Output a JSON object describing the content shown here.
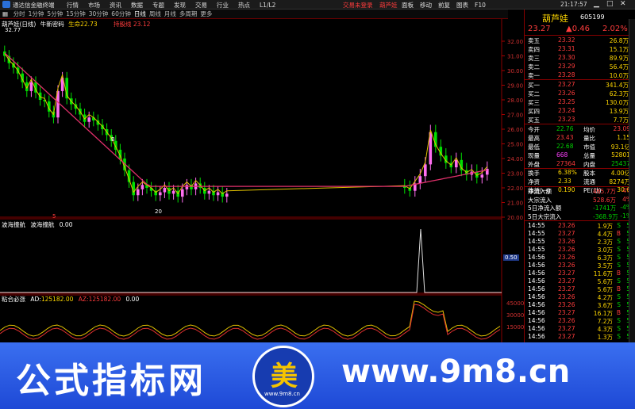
{
  "window": {
    "app_name": "通达信金融终端",
    "menu": [
      "行情",
      "市场",
      "资讯",
      "数据",
      "专题",
      "发现",
      "交易",
      "行业",
      "热点",
      "L1/L2"
    ],
    "login": "交易未登录",
    "stock_title": "葫芦娃",
    "toolbar": [
      "面板",
      "移动",
      "前复",
      "图表",
      "F10"
    ],
    "time": "21:17:57"
  },
  "chart_tabs": [
    "分时",
    "1分钟",
    "5分钟",
    "15分钟",
    "30分钟",
    "60分钟",
    "日线",
    "周线",
    "月线",
    "多周期",
    "更多"
  ],
  "main_chart": {
    "label": "葫芦娃(日线)",
    "formula": "牛新密码",
    "indicator": "生命",
    "indicator_value": "22.73",
    "support": "持股线",
    "support_value": "23.12",
    "high_label": "32.77",
    "low_label": "20",
    "price_axis": [
      "32.00",
      "31.00",
      "30.00",
      "29.00",
      "28.00",
      "27.00",
      "26.00",
      "25.00",
      "24.00",
      "23.00",
      "22.00",
      "21.00",
      "20.00"
    ],
    "marker": "B",
    "sub_value": "5"
  },
  "sub1": {
    "name": "波海撞航",
    "label": "波海撞航",
    "value": "0.00",
    "axis": "0.50"
  },
  "sub2": {
    "name": "粘合必涨",
    "ad_label": "AD:",
    "ad_value": "125182.00",
    "az_label": "AZ:",
    "az_value": "125182.00",
    "extra": "0.00",
    "axis": [
      "45000",
      "30000",
      "15000"
    ]
  },
  "quote": {
    "name": "葫芦娃",
    "code": "605199",
    "price": "23.27",
    "change": "▲0.46",
    "pct": "2.02%",
    "asks": [
      {
        "l": "卖五",
        "p": "23.32",
        "v": "26.8万"
      },
      {
        "l": "卖四",
        "p": "23.31",
        "v": "15.1万"
      },
      {
        "l": "卖三",
        "p": "23.30",
        "v": "89.9万"
      },
      {
        "l": "卖二",
        "p": "23.29",
        "v": "56.4万"
      },
      {
        "l": "卖一",
        "p": "23.28",
        "v": "10.0万"
      }
    ],
    "bids": [
      {
        "l": "买一",
        "p": "23.27",
        "v": "341.4万"
      },
      {
        "l": "买二",
        "p": "23.26",
        "v": "62.3万"
      },
      {
        "l": "买三",
        "p": "23.25",
        "v": "130.0万"
      },
      {
        "l": "买四",
        "p": "23.24",
        "v": "13.9万"
      },
      {
        "l": "买五",
        "p": "23.23",
        "v": "7.7万"
      }
    ],
    "stats": [
      [
        "今开",
        "22.76",
        "均价",
        "23.09"
      ],
      [
        "最高",
        "23.43",
        "量比",
        "1.15"
      ],
      [
        "最低",
        "22.68",
        "市值",
        "93.1亿"
      ],
      [
        "现量",
        "668",
        "总量",
        "52801"
      ],
      [
        "外盘",
        "27364",
        "内盘",
        "25437"
      ]
    ],
    "stats2": [
      [
        "换手",
        "6.38%",
        "股本",
        "4.00亿"
      ],
      [
        "净资",
        "2.33",
        "流通",
        "8274万"
      ],
      [
        "收益(一)",
        "0.190",
        "PE(动)",
        "30.6"
      ]
    ],
    "flows": [
      [
        "净流入额",
        "465.7万",
        "4%"
      ],
      [
        "大宗流入",
        "528.6万",
        "4%"
      ],
      [
        "5日净流入额",
        "-1741万",
        "-4%"
      ],
      [
        "5日大宗流入",
        "-368.9万",
        "-1%"
      ]
    ],
    "ticks": [
      [
        "14:55",
        "23.26",
        "1.9万",
        "S",
        "5"
      ],
      [
        "14:55",
        "23.27",
        "4.4万",
        "B",
        "5"
      ],
      [
        "14:55",
        "23.26",
        "2.3万",
        "S",
        "5"
      ],
      [
        "14:55",
        "23.26",
        "3.0万",
        "S",
        "5"
      ],
      [
        "14:56",
        "23.26",
        "6.3万",
        "S",
        "5"
      ],
      [
        "14:56",
        "23.26",
        "3.5万",
        "S",
        "5"
      ],
      [
        "14:56",
        "23.27",
        "11.6万",
        "B",
        "5"
      ],
      [
        "14:56",
        "23.27",
        "5.6万",
        "S",
        "5"
      ],
      [
        "14:56",
        "23.27",
        "5.6万",
        "B",
        "5"
      ],
      [
        "14:56",
        "23.26",
        "4.2万",
        "S",
        "5"
      ],
      [
        "14:56",
        "23.26",
        "3.6万",
        "S",
        "5"
      ],
      [
        "14:56",
        "23.27",
        "16.1万",
        "B",
        "5"
      ],
      [
        "14:56",
        "23.26",
        "7.2万",
        "S",
        "5"
      ],
      [
        "14:56",
        "23.27",
        "4.3万",
        "S",
        "5"
      ],
      [
        "14:56",
        "23.27",
        "1.3万",
        "S",
        "5"
      ]
    ]
  },
  "banner": {
    "left_text": "公式指标网",
    "right_text": "www.9m8.cn",
    "logo_char": "美",
    "logo_sub": "www.9m8.cn"
  }
}
